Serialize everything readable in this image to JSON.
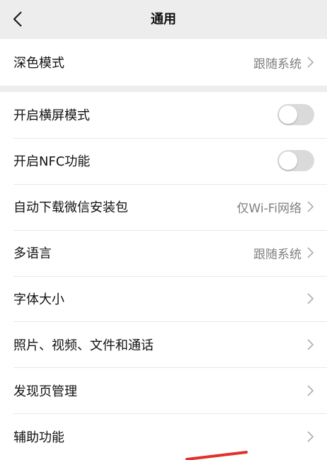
{
  "header": {
    "title": "通用",
    "back_icon": "chevron-left-icon"
  },
  "groups": [
    {
      "rows": [
        {
          "label": "深色模式",
          "value": "跟随系统",
          "type": "link"
        }
      ]
    },
    {
      "rows": [
        {
          "label": "开启横屏模式",
          "type": "toggle",
          "on": false
        },
        {
          "label": "开启NFC功能",
          "type": "toggle",
          "on": false
        },
        {
          "label": "自动下载微信安装包",
          "value": "仅Wi-Fi网络",
          "type": "link"
        },
        {
          "label": "多语言",
          "value": "跟随系统",
          "type": "link"
        },
        {
          "label": "字体大小",
          "type": "link"
        },
        {
          "label": "照片、视频、文件和通话",
          "type": "link"
        },
        {
          "label": "发现页管理",
          "type": "link"
        },
        {
          "label": "辅助功能",
          "type": "link"
        }
      ]
    }
  ],
  "colors": {
    "background": "#ededed",
    "card": "#ffffff",
    "secondary_text": "#7f7f7f",
    "toggle_off": "#dadada",
    "annotation": "#e0322a"
  }
}
